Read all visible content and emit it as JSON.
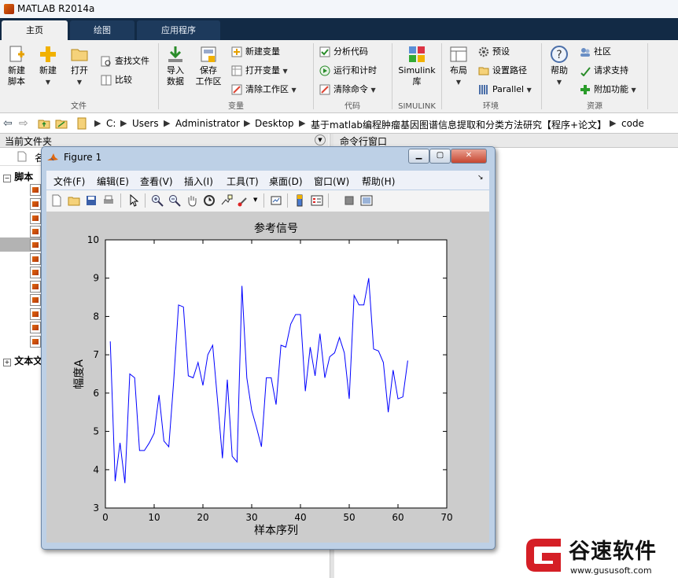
{
  "app": {
    "title": "MATLAB R2014a"
  },
  "tabs": [
    {
      "label": "主页",
      "active": true
    },
    {
      "label": "绘图",
      "active": false
    },
    {
      "label": "应用程序",
      "active": false
    }
  ],
  "ribbon": {
    "file": {
      "group_label": "文件",
      "new_script": "新建\n脚本",
      "new": "新建",
      "open": "打开",
      "find_files": "查找文件",
      "compare": "比较"
    },
    "variable": {
      "group_label": "变量",
      "import": "导入\n数据",
      "save_workspace": "保存\n工作区",
      "new_variable": "新建变量",
      "open_variable": "打开变量",
      "clear_workspace": "清除工作区"
    },
    "code": {
      "group_label": "代码",
      "analyze": "分析代码",
      "run_time": "运行和计时",
      "clear_commands": "清除命令"
    },
    "simulink": {
      "group_label": "SIMULINK",
      "button": "Simulink\n库"
    },
    "environment": {
      "group_label": "环境",
      "layout": "布局",
      "preferences": "预设",
      "set_path": "设置路径",
      "parallel": "Parallel"
    },
    "resources": {
      "group_label": "资源",
      "help": "帮助",
      "community": "社区",
      "request_support": "请求支持",
      "addons": "附加功能"
    }
  },
  "address": {
    "crumbs": [
      "C:",
      "Users",
      "Administrator",
      "Desktop",
      "基于matlab编程肿瘤基因图谱信息提取和分类方法研究【程序+论文】",
      "code"
    ]
  },
  "panels": {
    "current_folder": "当前文件夹",
    "command_window": "命令行窗口",
    "name_col": "名",
    "scripts": "脚本",
    "text_files": "文本文"
  },
  "figure": {
    "title": "Figure 1",
    "menu": [
      "文件(F)",
      "编辑(E)",
      "查看(V)",
      "插入(I)",
      "工具(T)",
      "桌面(D)",
      "窗口(W)",
      "帮助(H)"
    ]
  },
  "chart_data": {
    "type": "line",
    "title": "参考信号",
    "xlabel": "样本序列",
    "ylabel": "幅度A",
    "xlim": [
      0,
      70
    ],
    "ylim": [
      3,
      10
    ],
    "xticks": [
      0,
      10,
      20,
      30,
      40,
      50,
      60,
      70
    ],
    "yticks": [
      3,
      4,
      5,
      6,
      7,
      8,
      9,
      10
    ],
    "series_color": "#0000ff",
    "x": [
      1,
      2,
      3,
      4,
      5,
      6,
      7,
      8,
      9,
      10,
      11,
      12,
      13,
      14,
      15,
      16,
      17,
      18,
      19,
      20,
      21,
      22,
      23,
      24,
      25,
      26,
      27,
      28,
      29,
      30,
      31,
      32,
      33,
      34,
      35,
      36,
      37,
      38,
      39,
      40,
      41,
      42,
      43,
      44,
      45,
      46,
      47,
      48,
      49,
      50,
      51,
      52,
      53,
      54,
      55,
      56,
      57,
      58,
      59,
      60,
      61,
      62
    ],
    "y": [
      7.35,
      3.7,
      4.7,
      3.65,
      6.5,
      6.4,
      4.5,
      4.5,
      4.7,
      4.95,
      5.95,
      4.75,
      4.6,
      6.3,
      8.3,
      8.25,
      6.45,
      6.4,
      6.8,
      6.2,
      7.0,
      7.25,
      5.8,
      4.3,
      6.35,
      4.35,
      4.2,
      8.8,
      6.4,
      5.55,
      5.1,
      4.6,
      6.4,
      6.4,
      5.7,
      7.25,
      7.2,
      7.8,
      8.05,
      8.05,
      6.05,
      7.2,
      6.45,
      7.55,
      6.4,
      6.95,
      7.05,
      7.45,
      7.05,
      5.85,
      8.55,
      8.3,
      8.3,
      9.0,
      7.15,
      7.1,
      6.8,
      5.5,
      6.6,
      5.85,
      5.9,
      6.85
    ]
  },
  "watermark": {
    "brand": "谷速软件",
    "url": "www.gususoft.com"
  }
}
